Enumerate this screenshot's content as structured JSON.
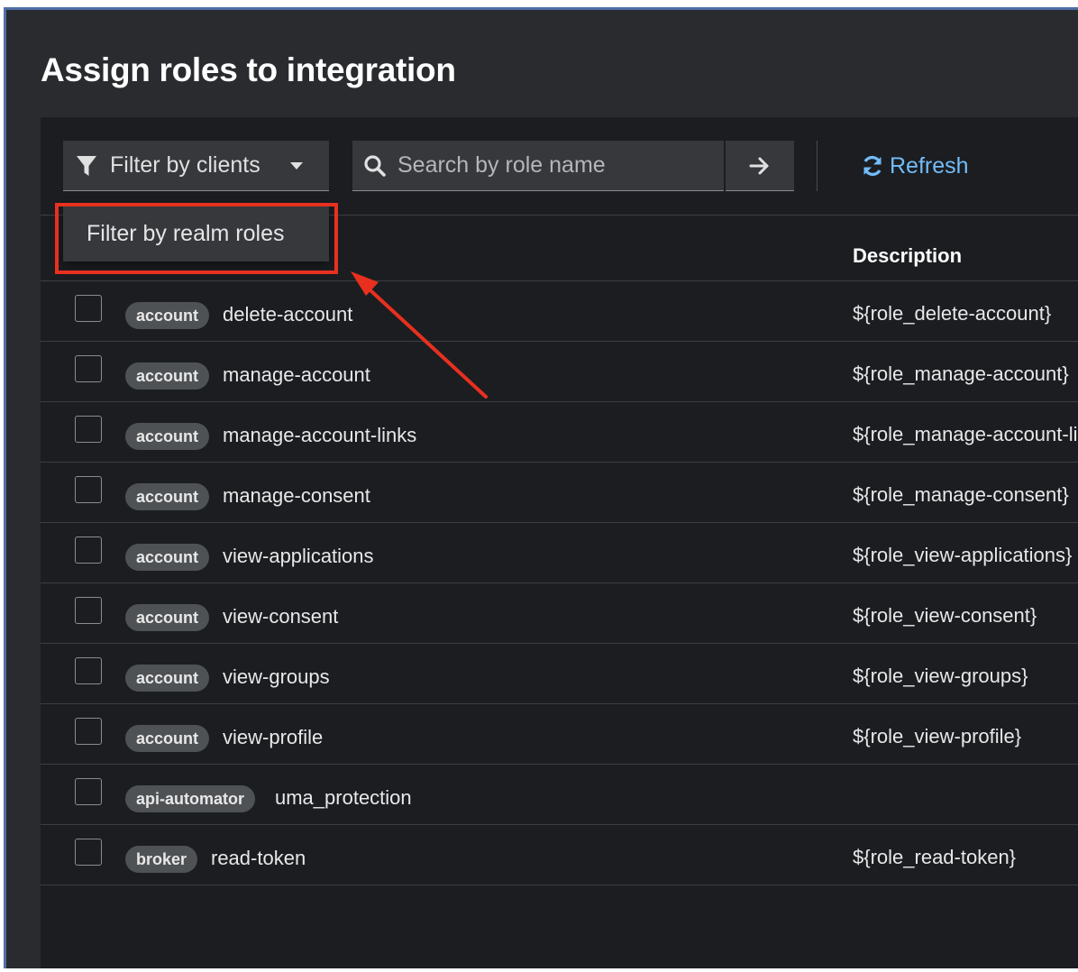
{
  "modal": {
    "title": "Assign roles to integration"
  },
  "toolbar": {
    "filter_label": "Filter by clients",
    "search_placeholder": "Search by role name",
    "refresh_label": "Refresh"
  },
  "dropdown": {
    "option": "Filter by realm roles"
  },
  "table": {
    "description_header": "Description",
    "rows": [
      {
        "client": "account",
        "role": "delete-account",
        "description": "${role_delete-account}"
      },
      {
        "client": "account",
        "role": "manage-account",
        "description": "${role_manage-account}"
      },
      {
        "client": "account",
        "role": "manage-account-links",
        "description": "${role_manage-account-li"
      },
      {
        "client": "account",
        "role": "manage-consent",
        "description": "${role_manage-consent}"
      },
      {
        "client": "account",
        "role": "view-applications",
        "description": "${role_view-applications}"
      },
      {
        "client": "account",
        "role": "view-consent",
        "description": "${role_view-consent}"
      },
      {
        "client": "account",
        "role": "view-groups",
        "description": "${role_view-groups}"
      },
      {
        "client": "account",
        "role": "view-profile",
        "description": "${role_view-profile}"
      },
      {
        "client": "api-automator",
        "role": "uma_protection",
        "description": ""
      },
      {
        "client": "broker",
        "role": "read-token",
        "description": "${role_read-token}"
      }
    ]
  },
  "colors": {
    "accent_link": "#73bcf7",
    "annotation_red": "#e8301f"
  }
}
